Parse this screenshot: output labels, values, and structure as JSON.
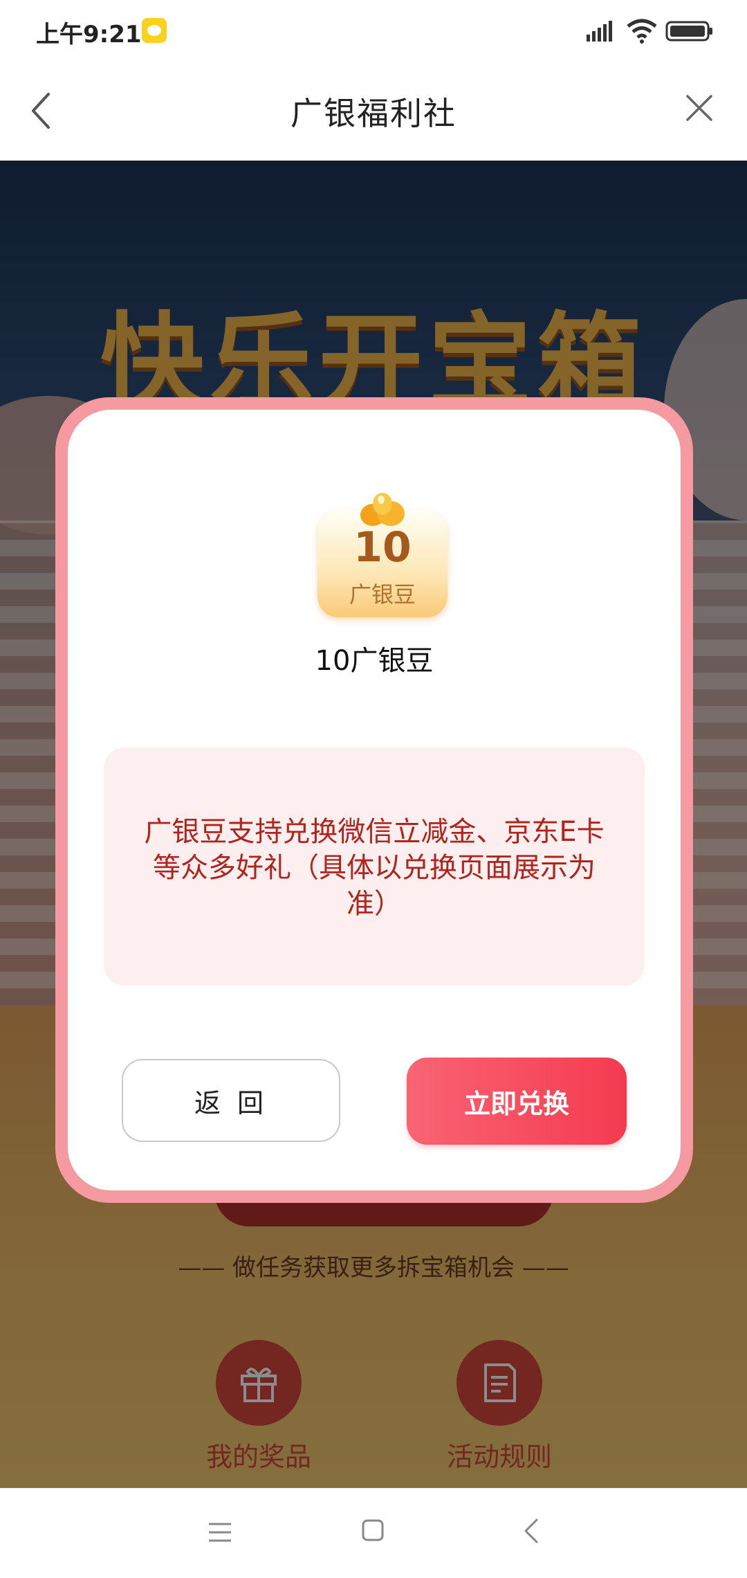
{
  "status_bar": {
    "time": "上午9:21",
    "app_icon": "app-notification-icon",
    "icons": [
      "signal-icon",
      "wifi-icon",
      "battery-icon"
    ]
  },
  "header": {
    "title": "广银福利社",
    "back_icon": "back-chevron-icon",
    "close_icon": "close-x-icon"
  },
  "background": {
    "banner_title": "快乐开宝箱",
    "more_chances_text": "—— 做任务获取更多拆宝箱机会 ——",
    "entries": [
      {
        "label": "我的奖品",
        "icon": "gift-icon"
      },
      {
        "label": "活动规则",
        "icon": "document-icon"
      }
    ]
  },
  "modal": {
    "prize_card": {
      "value": "10",
      "unit": "广银豆",
      "icon": "bean-icon"
    },
    "prize_name": "10广银豆",
    "info_text": "广银豆支持兑换微信立减金、京东E卡等众多好礼（具体以兑换页面展示为准）",
    "return_button": "返 回",
    "redeem_button": "立即兑换"
  },
  "colors": {
    "modal_border": "#f59aa0",
    "info_background": "#fdeef0",
    "info_text": "#b0241c",
    "redeem_gradient_start": "#f96473",
    "redeem_gradient_end": "#f53a50"
  },
  "bottom_nav": {
    "icons": [
      "menu-icon",
      "home-square-icon",
      "back-chevron-icon"
    ]
  }
}
